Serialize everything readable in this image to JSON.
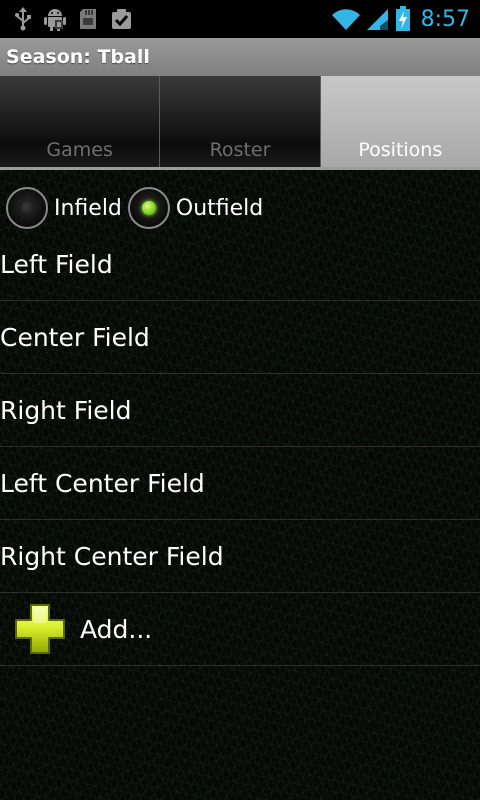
{
  "status_bar": {
    "left_icons": [
      "usb-icon",
      "android-debug-icon",
      "sd-card-icon",
      "checkbox-task-icon"
    ],
    "right_icons": [
      "wifi-icon",
      "signal-icon",
      "battery-charging-icon"
    ],
    "time": "8:57",
    "accent_color": "#33b5e5"
  },
  "title_bar": {
    "title": "Season: Tball"
  },
  "tabs": [
    {
      "label": "Games",
      "selected": false
    },
    {
      "label": "Roster",
      "selected": false
    },
    {
      "label": "Positions",
      "selected": true
    }
  ],
  "filter": {
    "options": [
      {
        "label": "Infield",
        "checked": false
      },
      {
        "label": "Outfield",
        "checked": true
      }
    ]
  },
  "positions": [
    {
      "label": "Left Field"
    },
    {
      "label": "Center Field"
    },
    {
      "label": "Right Field"
    },
    {
      "label": "Left Center Field"
    },
    {
      "label": "Right Center Field"
    }
  ],
  "add_row": {
    "icon": "plus-icon",
    "label": "Add..."
  }
}
